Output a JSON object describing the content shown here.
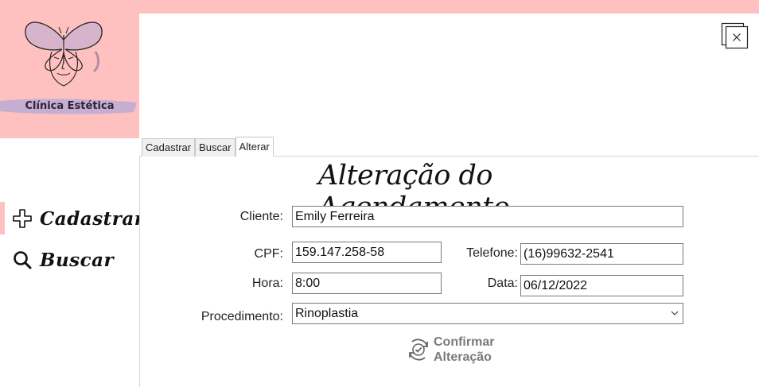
{
  "brand": {
    "name": "Clínica Estética"
  },
  "window": {
    "close_icon": "close-window-icon"
  },
  "nav": {
    "items": [
      {
        "label": "Cadastrar",
        "icon": "plus-icon"
      },
      {
        "label": "Buscar",
        "icon": "search-icon"
      }
    ]
  },
  "tabs": [
    {
      "label": "Cadastrar",
      "active": false
    },
    {
      "label": "Buscar",
      "active": false
    },
    {
      "label": "Alterar",
      "active": true
    }
  ],
  "form": {
    "title": "Alteração do Agendamento",
    "cliente": {
      "label": "Cliente:",
      "value": "Emily Ferreira"
    },
    "cpf": {
      "label": "CPF:",
      "value": "159.147.258-58"
    },
    "telefone": {
      "label": "Telefone:",
      "value": "(16)99632-2541"
    },
    "hora": {
      "label": "Hora:",
      "value": "8:00"
    },
    "data": {
      "label": "Data:",
      "value": "06/12/2022"
    },
    "procedimento": {
      "label": "Procedimento:",
      "value": "Rinoplastia"
    },
    "confirm": {
      "line1": "Confirmar",
      "line2": "Alteração",
      "icon": "check-cycle-icon"
    }
  },
  "colors": {
    "accent": "#ffc0c0",
    "butterfly": "#b7a9d6"
  }
}
